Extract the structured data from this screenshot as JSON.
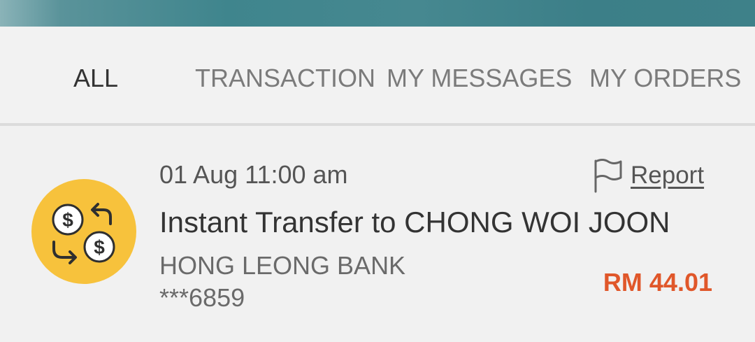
{
  "tabs": [
    {
      "label": "ALL",
      "active": true
    },
    {
      "label": "TRANSACTION",
      "active": false
    },
    {
      "label": "MY MESSAGES",
      "active": false
    },
    {
      "label": "MY ORDERS",
      "active": false
    }
  ],
  "transaction": {
    "icon": "currency-exchange-icon",
    "datetime": "01 Aug 11:00 am",
    "title": "Instant Transfer to CHONG WOI JOON",
    "bank": "HONG LEONG BANK",
    "account": "***6859",
    "report_label": "Report",
    "report_icon": "flag-icon",
    "amount": "RM 44.01"
  },
  "colors": {
    "header_bar": "#3f858d",
    "amount": "#e0572a",
    "icon_background": "#f7c23c",
    "active_tab": "#333333",
    "inactive_tab": "#7b7b7b"
  }
}
